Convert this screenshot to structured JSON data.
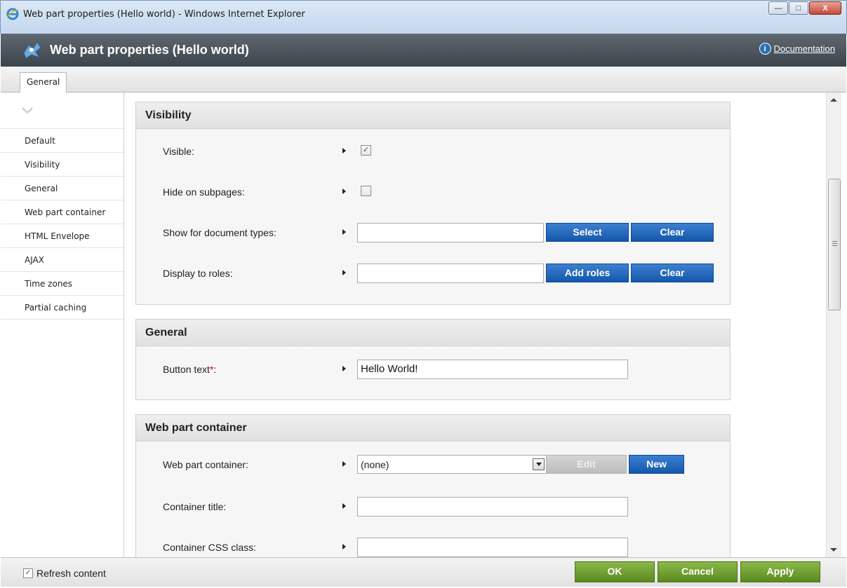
{
  "window": {
    "title": "Web part properties (Hello world) - Windows Internet Explorer",
    "minimize": "—",
    "maximize": "□",
    "close": "X"
  },
  "header": {
    "title": "Web part properties (Hello world)",
    "documentation_label": "Documentation",
    "info_icon": "i"
  },
  "tabs": [
    {
      "label": "General"
    }
  ],
  "nav": {
    "items": [
      {
        "label": "Default"
      },
      {
        "label": "Visibility"
      },
      {
        "label": "General"
      },
      {
        "label": "Web part container"
      },
      {
        "label": "HTML Envelope"
      },
      {
        "label": "AJAX"
      },
      {
        "label": "Time zones"
      },
      {
        "label": "Partial caching"
      }
    ]
  },
  "visibility": {
    "title": "Visibility",
    "visible_label": "Visible:",
    "visible_checked": true,
    "visible_mark": "✓",
    "hide_label": "Hide on subpages:",
    "hide_checked": false,
    "doctypes_label": "Show for document types:",
    "doctypes_value": "",
    "select_button": "Select",
    "clear_button": "Clear",
    "roles_label": "Display to roles:",
    "roles_value": "",
    "add_roles_button": "Add roles",
    "clear_roles_button": "Clear"
  },
  "general": {
    "title": "General",
    "button_text_label": "Button text",
    "required_mark": "*",
    "colon": ":",
    "button_text_value": "Hello World!"
  },
  "container": {
    "title": "Web part container",
    "container_label": "Web part container:",
    "container_value": "(none)",
    "edit_button": "Edit",
    "new_button": "New",
    "container_title_label": "Container title:",
    "container_title_value": "",
    "css_class_label": "Container CSS class:",
    "css_class_value": ""
  },
  "footer": {
    "refresh_label": "Refresh content",
    "refresh_checked": true,
    "refresh_mark": "✓",
    "ok_button": "OK",
    "cancel_button": "Cancel",
    "apply_button": "Apply"
  }
}
